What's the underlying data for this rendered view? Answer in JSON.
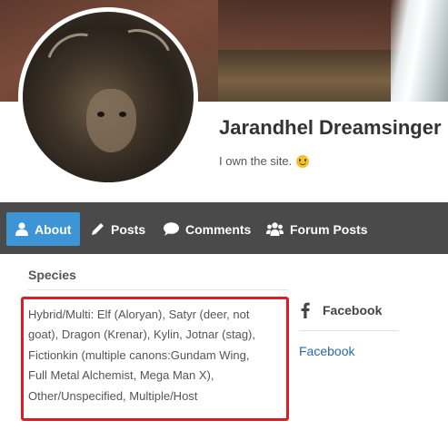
{
  "profile": {
    "name": "Jarandhel Dreamsinger",
    "bio": "I own the site."
  },
  "nav": {
    "items": [
      {
        "label": "About",
        "icon": "user-icon",
        "active": true
      },
      {
        "label": "Posts",
        "icon": "pencil-icon",
        "active": false
      },
      {
        "label": "Comments",
        "icon": "comment-icon",
        "active": false
      },
      {
        "label": "Forum Posts",
        "icon": "users-icon",
        "active": false
      }
    ]
  },
  "species": {
    "title": "Species",
    "lines": [
      "Hybrid/Multi: Elf (Aloryan), Satyr (deer, not",
      "goat), Dragon (Krenar), Kylin, Jotnar (stag),",
      "Fictionkin (multiple canons:Gundam Wing,",
      "Full Metal Alchemist, Mega Man X),",
      "Other/Unspecified, Multiple/Host"
    ],
    "highlight_color": "#e21b23"
  },
  "facebook": {
    "title": "Facebook",
    "link": "Facebook"
  },
  "colors": {
    "nav_bg": "#4a4a4a",
    "nav_active": "#3d95d6",
    "link": "#2a6aa3"
  }
}
